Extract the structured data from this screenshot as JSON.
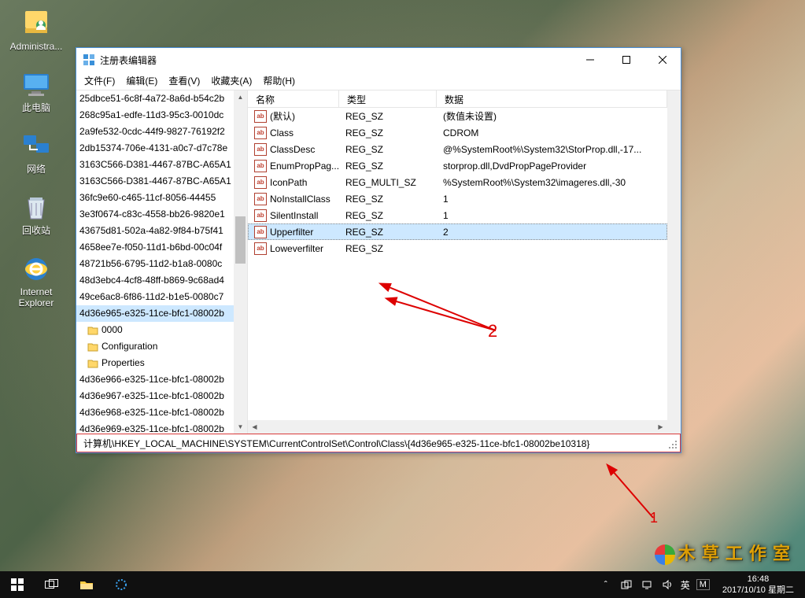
{
  "desktop": {
    "icons": [
      {
        "name": "administrator",
        "label": "Administra...",
        "glyph": "user"
      },
      {
        "name": "this-pc",
        "label": "此电脑",
        "glyph": "pc"
      },
      {
        "name": "network",
        "label": "网络",
        "glyph": "net"
      },
      {
        "name": "recycle-bin",
        "label": "回收站",
        "glyph": "bin"
      },
      {
        "name": "internet-explorer",
        "label": "Internet\nExplorer",
        "glyph": "ie"
      }
    ]
  },
  "window": {
    "title": "注册表编辑器",
    "menu": {
      "file": "文件(F)",
      "edit": "编辑(E)",
      "view": "查看(V)",
      "favorites": "收藏夹(A)",
      "help": "帮助(H)"
    },
    "tree": [
      "25dbce51-6c8f-4a72-8a6d-b54c2b",
      "268c95a1-edfe-11d3-95c3-0010dc",
      "2a9fe532-0cdc-44f9-9827-76192f2",
      "2db15374-706e-4131-a0c7-d7c78e",
      "3163C566-D381-4467-87BC-A65A1",
      "3163C566-D381-4467-87BC-A65A1",
      "36fc9e60-c465-11cf-8056-44455",
      "3e3f0674-c83c-4558-bb26-9820e1",
      "43675d81-502a-4a82-9f84-b75f41",
      "4658ee7e-f050-11d1-b6bd-00c04f",
      "48721b56-6795-11d2-b1a8-0080c",
      "48d3ebc4-4cf8-48ff-b869-9c68ad4",
      "49ce6ac8-6f86-11d2-b1e5-0080c7",
      "4d36e965-e325-11ce-bfc1-08002b",
      "0000",
      "Configuration",
      "Properties",
      "4d36e966-e325-11ce-bfc1-08002b",
      "4d36e967-e325-11ce-bfc1-08002b",
      "4d36e968-e325-11ce-bfc1-08002b",
      "4d36e969-e325-11ce-bfc1-08002b"
    ],
    "tree_selected_index": 13,
    "tree_folder_indices": [
      14,
      15,
      16
    ],
    "columns": {
      "name": "名称",
      "type": "类型",
      "data": "数据"
    },
    "col_widths": {
      "name": 116,
      "type": 124,
      "data": 260
    },
    "values": [
      {
        "name": "(默认)",
        "type": "REG_SZ",
        "data": "(数值未设置)"
      },
      {
        "name": "Class",
        "type": "REG_SZ",
        "data": "CDROM"
      },
      {
        "name": "ClassDesc",
        "type": "REG_SZ",
        "data": "@%SystemRoot%\\System32\\StorProp.dll,-17..."
      },
      {
        "name": "EnumPropPag...",
        "type": "REG_SZ",
        "data": "storprop.dll,DvdPropPageProvider"
      },
      {
        "name": "IconPath",
        "type": "REG_MULTI_SZ",
        "data": "%SystemRoot%\\System32\\imageres.dll,-30"
      },
      {
        "name": "NoInstallClass",
        "type": "REG_SZ",
        "data": "1"
      },
      {
        "name": "SilentInstall",
        "type": "REG_SZ",
        "data": "1"
      },
      {
        "name": "Upperfilter",
        "type": "REG_SZ",
        "data": "2",
        "selected": true
      },
      {
        "name": "Loweverfilter",
        "type": "REG_SZ",
        "data": ""
      }
    ],
    "statusbar": "计算机\\HKEY_LOCAL_MACHINE\\SYSTEM\\CurrentControlSet\\Control\\Class\\{4d36e965-e325-11ce-bfc1-08002be10318}"
  },
  "annotations": {
    "label_1": "1",
    "label_2": "2"
  },
  "watermark": "木 草 工 作 室",
  "taskbar": {
    "tray": {
      "ime_lang": "英",
      "ime_mode": "M"
    },
    "clock": {
      "time": "16:48",
      "date": "2017/10/10 星期二"
    }
  }
}
